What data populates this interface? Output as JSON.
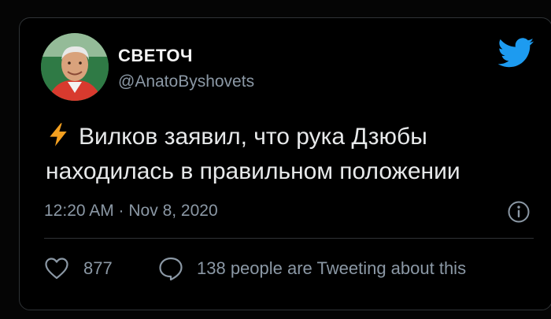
{
  "author": {
    "name": "СВЕТОЧ",
    "handle": "@AnatoByshovets"
  },
  "icons": {
    "brand": "twitter-bird-icon",
    "prefix": "lightning-bolt-icon",
    "info": "info-icon",
    "like": "heart-icon",
    "reply": "speech-bubble-icon"
  },
  "tweet": {
    "text": "Вилков заявил, что рука Дзюбы находилась в правильном положении",
    "timestamp": "12:20 AM · Nov 8, 2020"
  },
  "stats": {
    "likes": "877",
    "tweeting": "138 people are Tweeting about this"
  },
  "colors": {
    "background": "#000000",
    "text": "#e7e9ea",
    "secondary_text": "#8b98a5",
    "accent": "#1d9bf0",
    "bolt": "#f4a020",
    "border": "#2f3336"
  }
}
